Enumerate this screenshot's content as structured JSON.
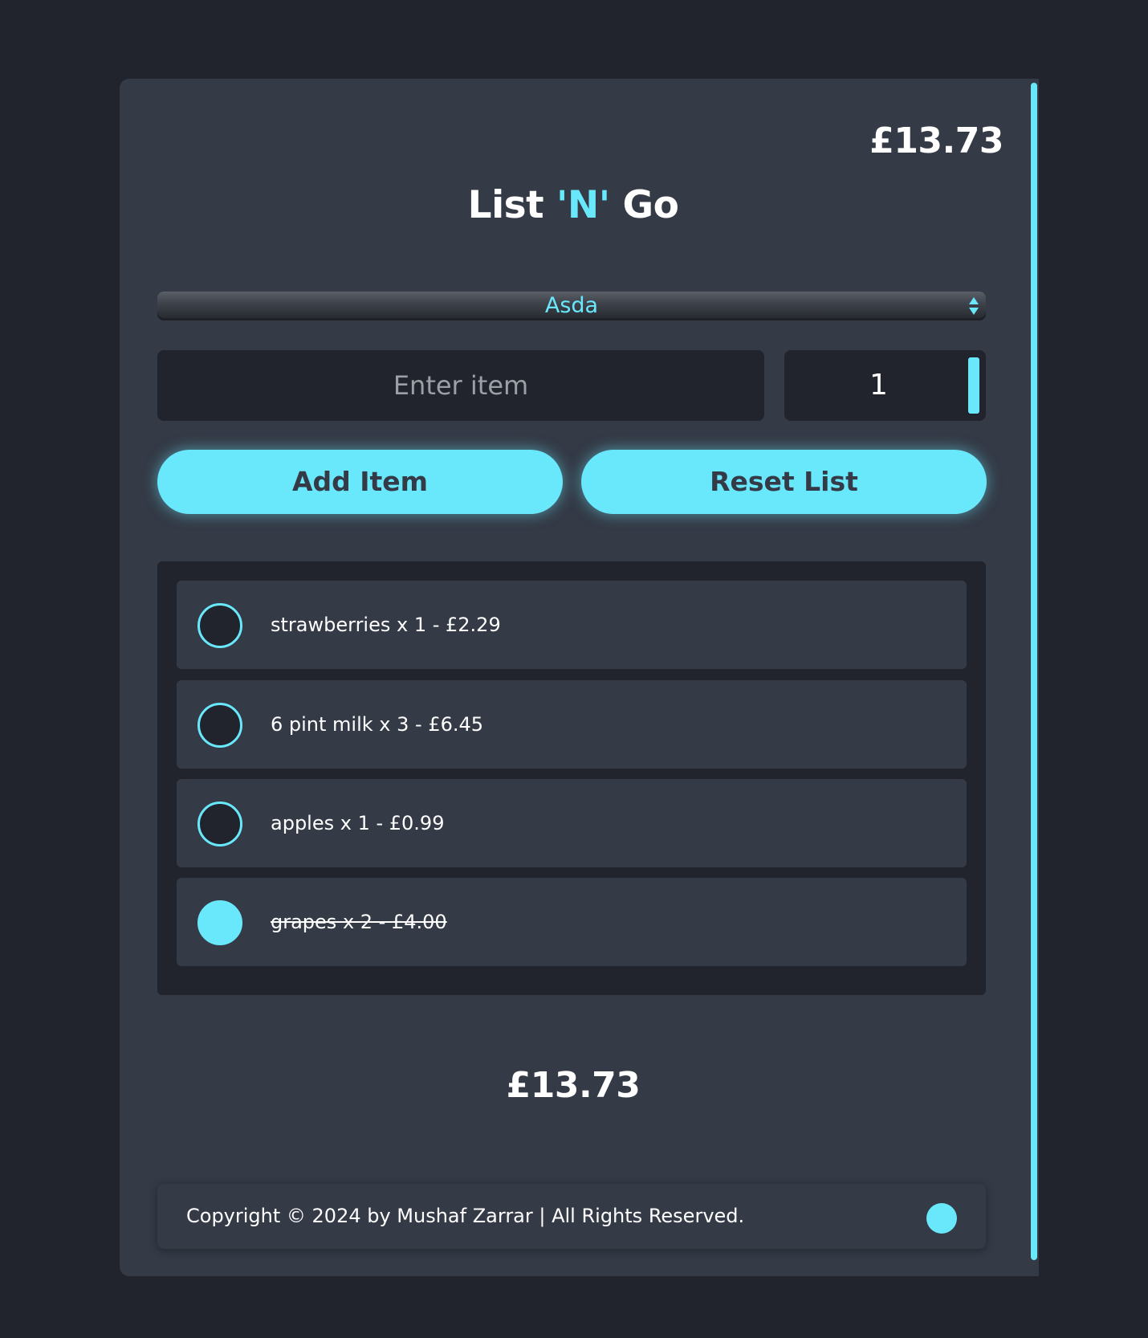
{
  "header": {
    "total": "£13.73",
    "title_part1": "List ",
    "title_accent": "'N'",
    "title_part2": " Go"
  },
  "form": {
    "store_selected": "Asda",
    "item_placeholder": "Enter item",
    "quantity": "1",
    "add_label": "Add Item",
    "reset_label": "Reset List"
  },
  "items": [
    {
      "text": "strawberries x 1 - £2.29",
      "checked": false
    },
    {
      "text": "6 pint milk x 3 - £6.45",
      "checked": false
    },
    {
      "text": "apples x 1 - £0.99",
      "checked": false
    },
    {
      "text": "grapes x 2 - £4.00",
      "checked": true
    }
  ],
  "summary": {
    "total": "£13.73"
  },
  "footer": {
    "copyright": "Copyright © 2024 by Mushaf Zarrar | All Rights Reserved."
  },
  "colors": {
    "accent": "#6ae8fb",
    "background": "#21242c",
    "card": "#343a46"
  }
}
